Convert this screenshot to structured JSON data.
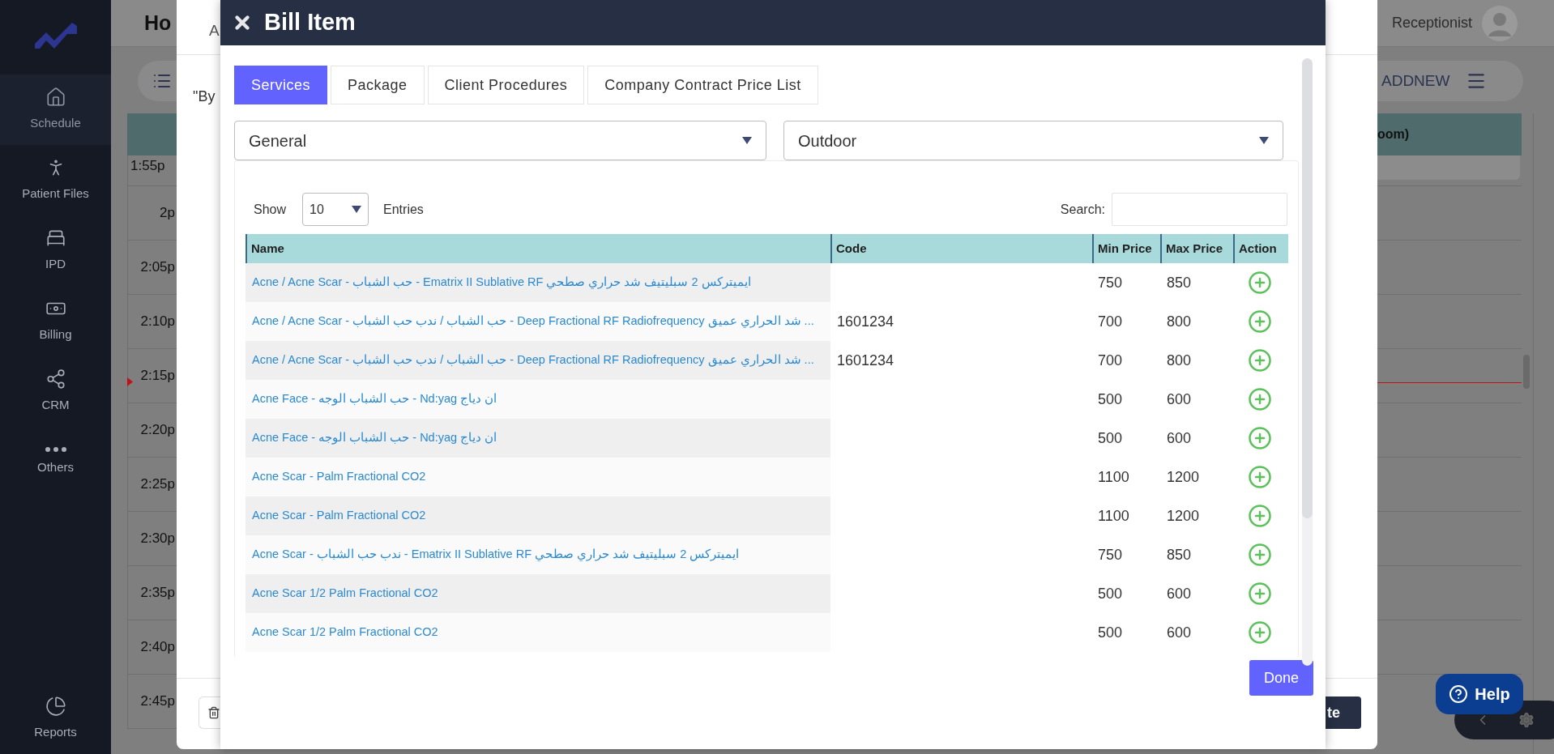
{
  "sidebar": {
    "items": [
      {
        "label": "Schedule",
        "kind": "home",
        "selected": true
      },
      {
        "label": "Patient Files",
        "kind": "person",
        "selected": false
      },
      {
        "label": "IPD",
        "kind": "bed",
        "selected": false
      },
      {
        "label": "Billing",
        "kind": "money",
        "selected": false
      },
      {
        "label": "CRM",
        "kind": "nodes",
        "selected": false
      },
      {
        "label": "Others",
        "kind": "more",
        "selected": false
      }
    ],
    "footer_item": {
      "label": "Reports",
      "kind": "pie"
    }
  },
  "background": {
    "page_title": "Ho",
    "user": "Receptionist",
    "add_button": "ADDNEW",
    "column_header": "oom)",
    "times": [
      "1:55p",
      "2p",
      "2:05p",
      "2:10p",
      "2:15p",
      "2:20p",
      "2:25p",
      "2:30p",
      "2:35p",
      "2:40p",
      "2:45p"
    ]
  },
  "underlying_dialog": {
    "tab": "A",
    "text": "\"By",
    "save_button": "te"
  },
  "dialog": {
    "title": "Bill Item",
    "tabs": [
      {
        "label": "Services",
        "selected": true
      },
      {
        "label": "Package",
        "selected": false
      },
      {
        "label": "Client Procedures",
        "selected": false
      },
      {
        "label": "Company Contract Price List",
        "selected": false
      }
    ],
    "selects": [
      {
        "value": "General"
      },
      {
        "value": "Outdoor"
      }
    ],
    "show_label": "Show",
    "page_size": "10",
    "entries_label": "Entries",
    "search_label": "Search:",
    "columns": [
      "Name",
      "Code",
      "Min Price",
      "Max Price",
      "Action"
    ],
    "rows": [
      {
        "name": "Acne / Acne Scar - حب الشباب - Ematrix II Sublative RF ايميتركس 2 سبليتيف شد حراري صطحي",
        "min_price": "750",
        "max_price": "850"
      },
      {
        "name": "Acne / Acne Scar - حب الشباب / ندب حب الشباب - Deep Fractional RF Radiofrequency شد الحراري عميق ...",
        "code": "1601234",
        "min_price": "700",
        "max_price": "800"
      },
      {
        "name": "Acne / Acne Scar - حب الشباب / ندب حب الشباب - Deep Fractional RF Radiofrequency شد الحراري عميق ...",
        "code": "1601234",
        "min_price": "700",
        "max_price": "800"
      },
      {
        "name": "Acne Face - حب الشباب الوجه - Nd:yag ان دياج",
        "min_price": "500",
        "max_price": "600"
      },
      {
        "name": "Acne Face - حب الشباب الوجه - Nd:yag ان دياج",
        "min_price": "500",
        "max_price": "600"
      },
      {
        "name": "Acne Scar - Palm Fractional CO2",
        "min_price": "1100",
        "max_price": "1200"
      },
      {
        "name": "Acne Scar - Palm Fractional CO2",
        "min_price": "1100",
        "max_price": "1200"
      },
      {
        "name": "Acne Scar - ندب حب الشباب - Ematrix II Sublative RF ايميتركس 2 سبليتيف شد حراري صطحي",
        "min_price": "750",
        "max_price": "850"
      },
      {
        "name": "Acne Scar 1/2 Palm Fractional CO2",
        "min_price": "500",
        "max_price": "600"
      },
      {
        "name": "Acne Scar 1/2 Palm Fractional CO2",
        "min_price": "500",
        "max_price": "600"
      }
    ],
    "done_button": "Done"
  },
  "help_button": "Help"
}
